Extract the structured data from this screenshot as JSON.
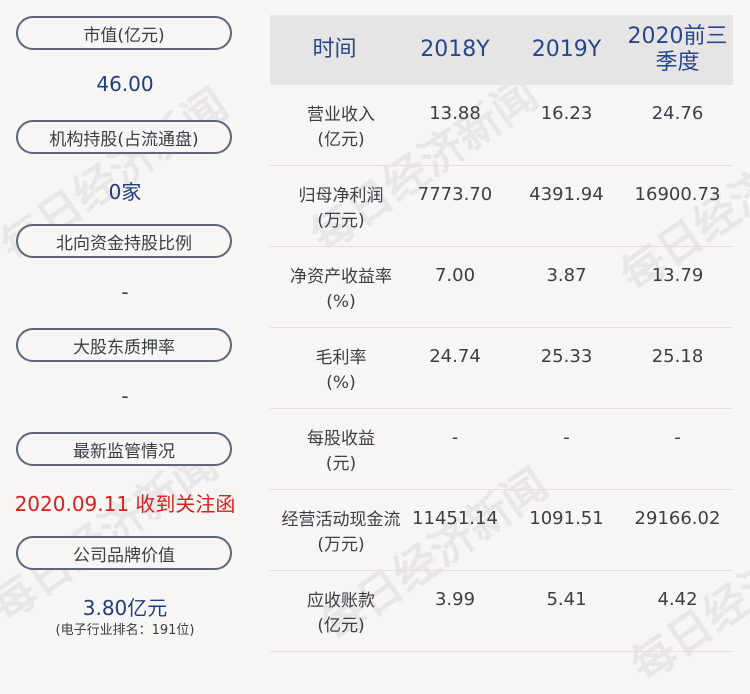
{
  "left": [
    {
      "label": "市值(亿元)",
      "value": "46.00"
    },
    {
      "label": "机构持股(占流通盘)",
      "value": "0家"
    },
    {
      "label": "北向资金持股比例",
      "value": "-"
    },
    {
      "label": "大股东质押率",
      "value": "-"
    },
    {
      "label": "最新监管情况",
      "value": "2020.09.11 收到关注函"
    },
    {
      "label": "公司品牌价值",
      "value": "3.80亿元",
      "sub": "(电子行业排名：191位)"
    }
  ],
  "table": {
    "headers": [
      "时间",
      "2018Y",
      "2019Y",
      "2020前三季度"
    ],
    "rows": [
      {
        "l1": "营业收入",
        "l2": "(亿元)",
        "v": [
          "13.88",
          "16.23",
          "24.76"
        ]
      },
      {
        "l1": "归母净利润",
        "l2": "(万元)",
        "v": [
          "7773.70",
          "4391.94",
          "16900.73"
        ]
      },
      {
        "l1": "净资产收益率",
        "l2": "(%)",
        "v": [
          "7.00",
          "3.87",
          "13.79"
        ]
      },
      {
        "l1": "毛利率",
        "l2": "(%)",
        "v": [
          "24.74",
          "25.33",
          "25.18"
        ]
      },
      {
        "l1": "每股收益",
        "l2": "(元)",
        "v": [
          "-",
          "-",
          "-"
        ]
      },
      {
        "l1": "经营活动现金流",
        "l2": "(万元)",
        "v": [
          "11451.14",
          "1091.51",
          "29166.02"
        ]
      },
      {
        "l1": "应收账款",
        "l2": "(亿元)",
        "v": [
          "3.99",
          "5.41",
          "4.42"
        ]
      }
    ]
  },
  "watermark": "每日经济新闻",
  "colors": {
    "accent": "#1f3f7a",
    "alert": "#d8201f",
    "header_bg": "#e7e4e5"
  }
}
